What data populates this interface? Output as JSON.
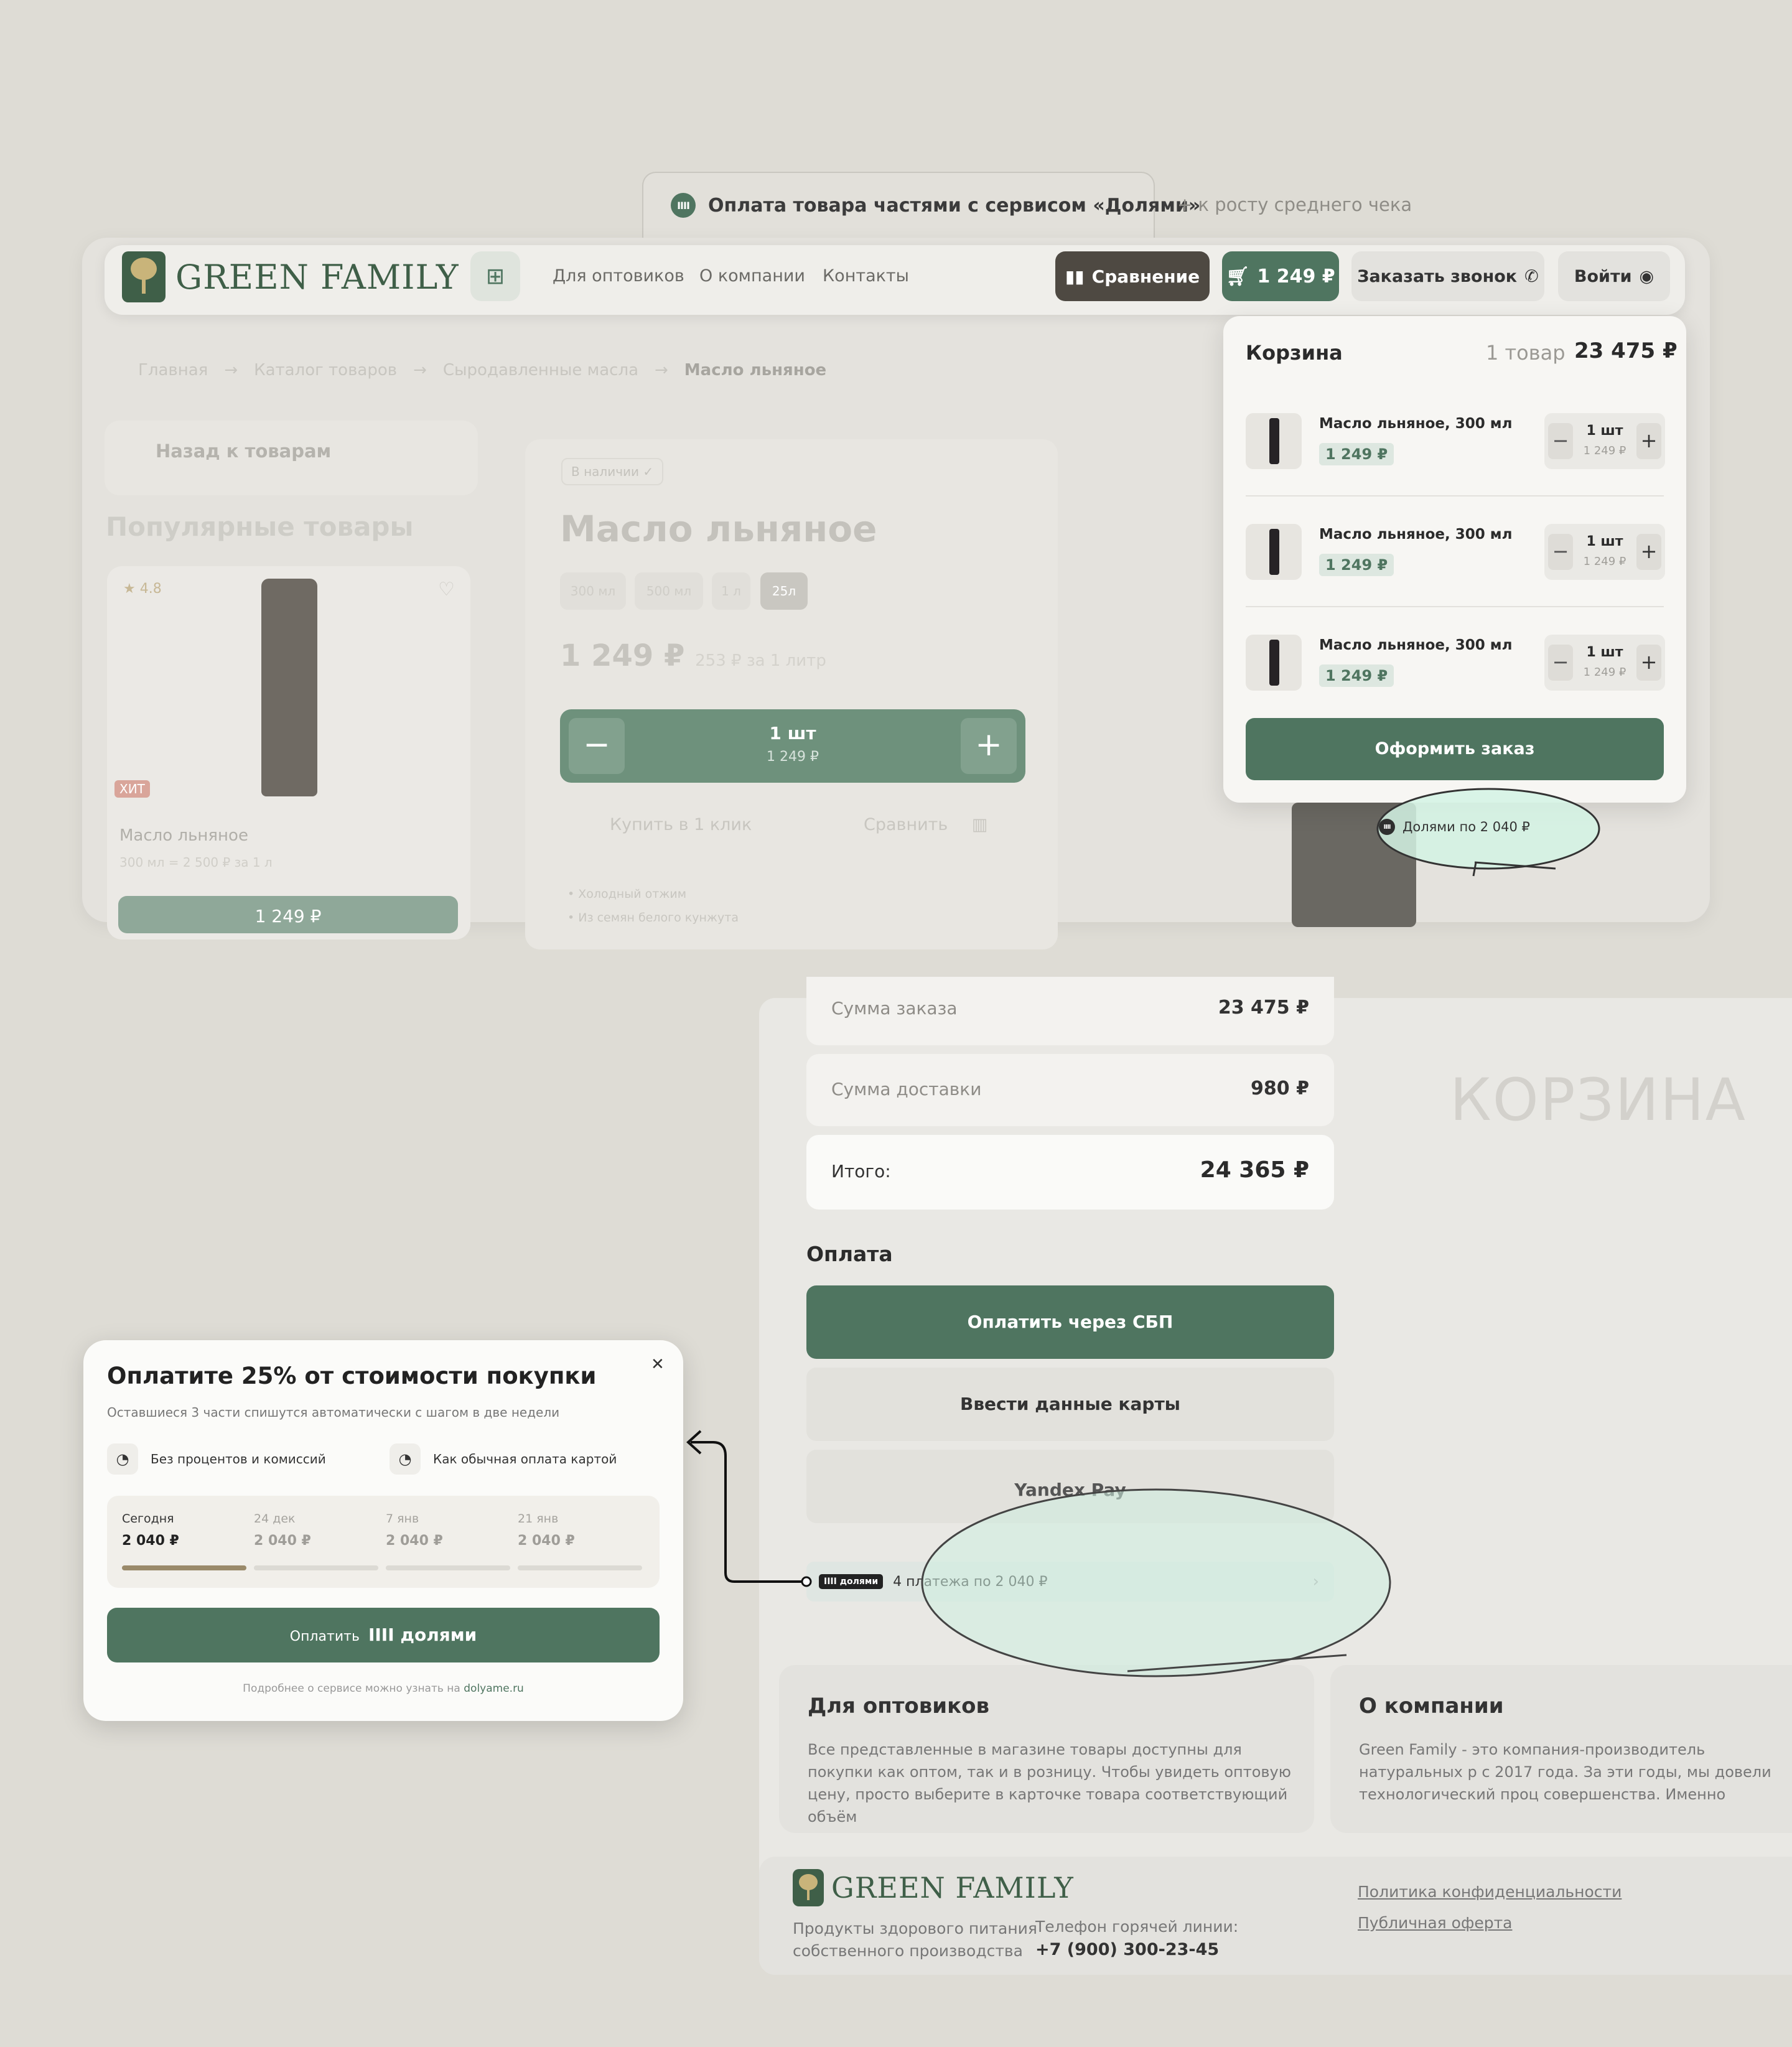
{
  "tab": {
    "main": "Оплата товара частями с сервисом «Долями»",
    "extra": "+ к росту среднего чека",
    "icon": "dolyame-icon"
  },
  "header": {
    "logo": "GREEN FAMILY",
    "nav": [
      "Для оптовиков",
      "О компании",
      "Контакты"
    ],
    "compare": "Сравнение",
    "cart": "1 249 ₽",
    "call": "Заказать звонок",
    "login": "Войти"
  },
  "breadcrumb": [
    "Главная",
    "Каталог товаров",
    "Сыродавленные масла",
    "Масло льняное"
  ],
  "sidebar": {
    "back": "Назад к товарам",
    "popular": "Популярные товары",
    "rating": "4.8",
    "hit": "ХИТ",
    "card_name": "Масло льняное",
    "card_meta": "300 мл",
    "card_meta2": "= 2 500 ₽ за 1 л",
    "card_price": "1 249 ₽"
  },
  "product": {
    "instock": "В наличии",
    "name": "Масло льняное",
    "volumes": [
      "300 мл",
      "500 мл",
      "1 л",
      "25л"
    ],
    "price": "1 249 ₽",
    "price_per": "253 ₽ за 1 литр",
    "qty": "1 шт",
    "qty_price": "1 249 ₽",
    "buy_one": "Купить в 1 клик",
    "compare": "Сравнить",
    "bullets": [
      "Холодный отжим",
      "Из семян белого кунжута"
    ]
  },
  "cart": {
    "title": "Корзина",
    "count": "1 товар",
    "total": "23 475 ₽",
    "items": [
      {
        "name": "Масло льняное, 300 мл",
        "price": "1 249 ₽",
        "qty": "1 шт",
        "qty_price": "1 249 ₽"
      },
      {
        "name": "Масло льняное, 300 мл",
        "price": "1 249 ₽",
        "qty": "1 шт",
        "qty_price": "1 249 ₽"
      },
      {
        "name": "Масло льняное, 300 мл",
        "price": "1 249 ₽",
        "qty": "1 шт",
        "qty_price": "1 249 ₽"
      }
    ],
    "checkout": "Оформить заказ",
    "dolyame": "Долями по 2 040 ₽"
  },
  "checkout": {
    "order_sum_label": "Сумма заказа",
    "order_sum": "23 475 ₽",
    "delivery_label": "Сумма доставки",
    "delivery": "980 ₽",
    "total_label": "Итого:",
    "total": "24 365 ₽",
    "page_title": "КОРЗИНА",
    "payment_title": "Оплата",
    "pay_sbp": "Оплатить через СБП",
    "pay_card": "Ввести данные карты",
    "pay_yandex": "Yandex Pay",
    "dolyame_badge": "IIII долями",
    "dolyame_text": "4 платежа по 2 040 ₽"
  },
  "info": {
    "wholesale_title": "Для оптовиков",
    "wholesale_text": "Все представленные в магазине товары доступны для покупки как оптом, так и в розницу. Чтобы увидеть оптовую цену, просто выберите в карточке товара соответствующий объём",
    "about_title": "О компании",
    "about_text": "Green Family - это компания-производитель натуральных р с 2017 года. За эти годы, мы довели технологический проц совершенства. Именно поэтому, наши продукты всегда вку"
  },
  "footer": {
    "logo": "GREEN FAMILY",
    "desc1": "Продукты здорового питания",
    "desc2": "собственного производства",
    "phone_label": "Телефон горячей линии:",
    "phone": "+7 (900) 300-23-45",
    "privacy": "Политика конфиденциальности",
    "offer": "Публичная оферта"
  },
  "modal": {
    "title": "Оплатите 25% от стоимости покупки",
    "subtitle": "Оставшиеся 3 части спишутся автоматически с шагом в две недели",
    "feat1": "Без процентов и комиссий",
    "feat2": "Как обычная оплата картой",
    "schedule": [
      {
        "date": "Сегодня",
        "amount": "2 040 ₽"
      },
      {
        "date": "24 дек",
        "amount": "2 040 ₽"
      },
      {
        "date": "7 янв",
        "amount": "2 040 ₽"
      },
      {
        "date": "21 янв",
        "amount": "2 040 ₽"
      }
    ],
    "pay_prefix": "Оплатить",
    "pay_brand": "IIII долями",
    "note_prefix": "Подробнее о сервисе можно узнать на",
    "note_link": "dolyame.ru"
  },
  "colors": {
    "brand_green": "#4f7560",
    "dark_button": "#4e4942",
    "highlight": "#d4f3e4",
    "background": "#dedcd5"
  }
}
